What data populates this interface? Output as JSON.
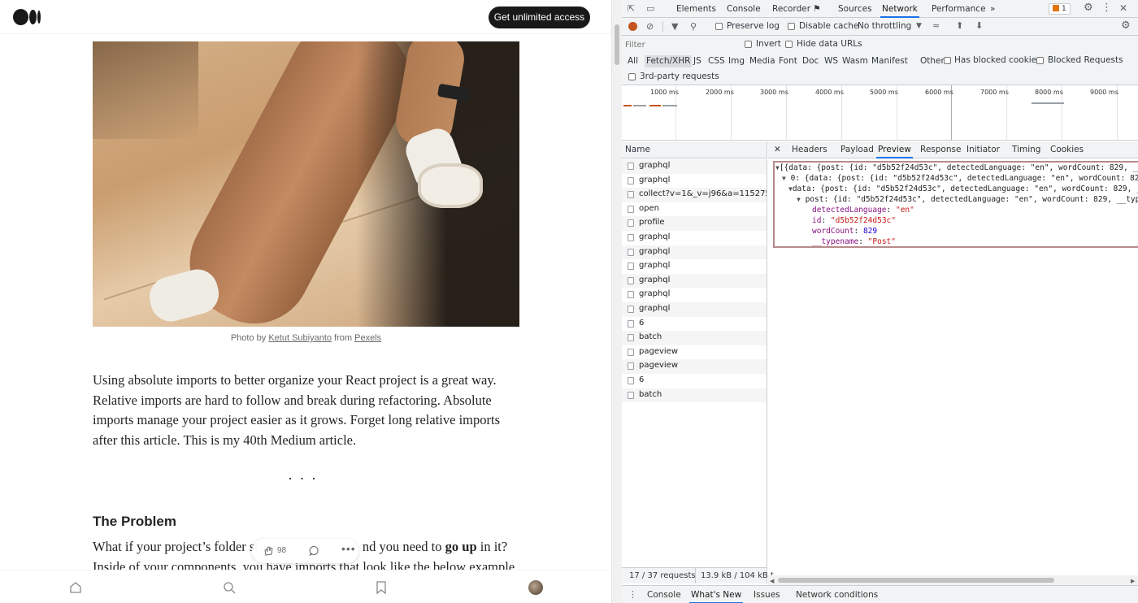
{
  "article": {
    "cta_label": "Get unlimited access",
    "caption": {
      "prefix": "Photo by ",
      "author": "Ketut Subiyanto",
      "middle": " from ",
      "source": "Pexels"
    },
    "para1": "Using absolute imports to better organize your React project is a great way. Relative imports are hard to follow and break during refactoring. Absolute imports manage your project easier as it grows. Forget long relative imports after this article. This is my 40th Medium article.",
    "separator": "...",
    "heading": "The Problem",
    "para2_a": "What if your project’s folder st",
    "para2_b": "nd you need to ",
    "para2_bold": "go up",
    "para2_c": " in it? Inside of your components, you have imports that look like the below example",
    "clap_count": "98",
    "more_label": "•••"
  },
  "devtools": {
    "tabs": [
      "Elements",
      "Console",
      "Recorder ⚑",
      "Sources",
      "Network",
      "Performance"
    ],
    "active_tab": "Network",
    "more_tabs": "»",
    "issues_badge": "1",
    "toolbar": {
      "preserve_log": "Preserve log",
      "disable_cache": "Disable cache",
      "throttling": "No throttling"
    },
    "filter": {
      "placeholder": "Filter",
      "invert": "Invert",
      "hide_data_urls": "Hide data URLs"
    },
    "types": [
      "All",
      "Fetch/XHR",
      "JS",
      "CSS",
      "Img",
      "Media",
      "Font",
      "Doc",
      "WS",
      "Wasm",
      "Manifest",
      "Other"
    ],
    "active_type": "Fetch/XHR",
    "has_blocked_cookies": "Has blocked cookies",
    "blocked_requests": "Blocked Requests",
    "third_party": "3rd-party requests",
    "ticks": [
      "1000 ms",
      "2000 ms",
      "3000 ms",
      "4000 ms",
      "5000 ms",
      "6000 ms",
      "7000 ms",
      "8000 ms",
      "9000 ms"
    ],
    "name_header": "Name",
    "requests": [
      "graphql",
      "graphql",
      "collect?v=1&_v=j96&a=1152751...",
      "open",
      "profile",
      "graphql",
      "graphql",
      "graphql",
      "graphql",
      "graphql",
      "graphql",
      "6",
      "batch",
      "pageview",
      "pageview",
      "6",
      "batch"
    ],
    "detail_close": "✕",
    "detail_tabs": [
      "Headers",
      "Payload",
      "Preview",
      "Response",
      "Initiator",
      "Timing",
      "Cookies"
    ],
    "active_detail_tab": "Preview",
    "preview": {
      "line1": "[{data: {post: {id: \"d5b52f24d53c\", detectedLanguage: \"en\", wordCount: 829, __ty",
      "line2": "0: {data: {post: {id: \"d5b52f24d53c\", detectedLanguage: \"en\", wordCount: 829, __",
      "line3": "data: {post: {id: \"d5b52f24d53c\", detectedLanguage: \"en\", wordCount: 829, __",
      "line4": "post: {id: \"d5b52f24d53c\", detectedLanguage: \"en\", wordCount: 829, __typena",
      "lang_key": "detectedLanguage",
      "lang_val": "\"en\"",
      "id_key": "id",
      "id_val": "\"d5b52f24d53c\"",
      "wc_key": "wordCount",
      "wc_val": "829",
      "tn_key": "__typename",
      "tn_val": "\"Post\""
    },
    "status": {
      "requests": "17 / 37 requests",
      "transferred": "13.9 kB / 104 kB t"
    },
    "drawer_tabs": [
      "Console",
      "What's New",
      "Issues",
      "Network conditions"
    ],
    "active_drawer_tab": "What's New",
    "colors": {
      "accent": "#1a73e8",
      "record": "#c5551f"
    }
  }
}
